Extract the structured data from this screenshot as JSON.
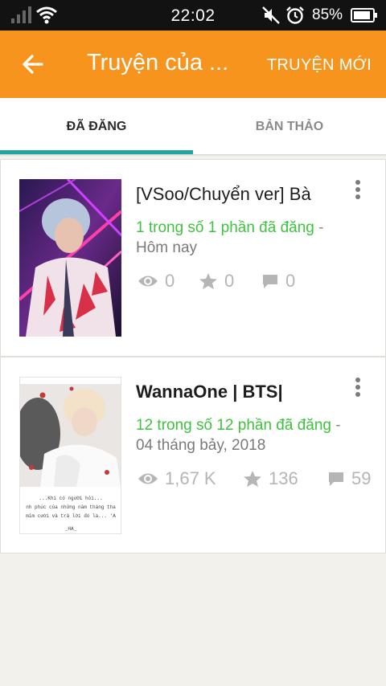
{
  "status_bar": {
    "time": "22:02",
    "battery": "85%"
  },
  "app_bar": {
    "title": "Truyện của ...",
    "action": "TRUYỆN MỚI"
  },
  "tabs": [
    {
      "label": "ĐÃ ĐĂNG",
      "active": true
    },
    {
      "label": "BẢN THẢO",
      "active": false
    }
  ],
  "stories": [
    {
      "title": "[VSoo/Chuyển ver] Bà",
      "parts": "1 trong số 1 phần đã đăng",
      "date": "Hôm nay",
      "views": "0",
      "votes": "0",
      "comments": "0"
    },
    {
      "title": "WannaOne | BTS|",
      "parts": "12 trong số 12 phần đã đăng",
      "date": "04 tháng bảy, 2018",
      "views": "1,67 K",
      "votes": "136",
      "comments": "59",
      "cover_text": {
        "line1": "...Khi có người hỏi...",
        "line2": "nh phúc của những năm tháng tha",
        "line3": "mỉm cười và trả lời đó là... 'A",
        "sign": "_HA_"
      }
    }
  ],
  "colors": {
    "accent": "#f7941d",
    "tab_indicator": "#20a3a0",
    "parts_text": "#3ec33e"
  }
}
